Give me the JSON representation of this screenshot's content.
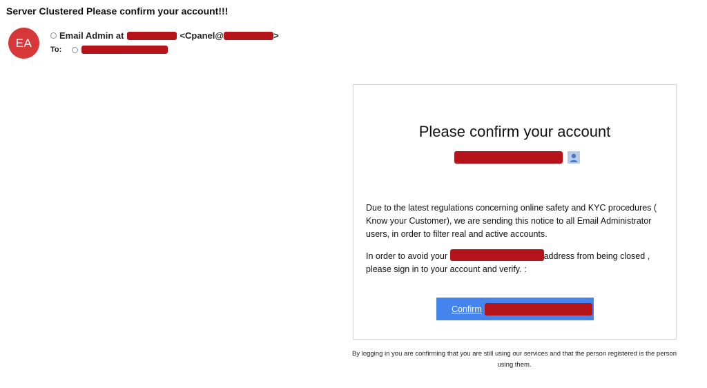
{
  "email": {
    "subject": "Server Clustered Please confirm your account!!!",
    "avatar_initials": "EA",
    "from_prefix": "Email Admin at",
    "from_mid": "<Cpanel@",
    "from_suffix": ">",
    "to_label": "To:"
  },
  "card": {
    "title": "Please confirm your account",
    "paragraph1": "Due to the latest regulations concerning online safety and KYC procedures ( Know your Customer), we are sending this notice to all Email Administrator users, in order to filter real and active accounts.",
    "paragraph2_before": "In order to avoid your ",
    "paragraph2_after": "address from being closed  , please sign in to your account and verify. :",
    "confirm_label": "Confirm",
    "account_icon": "person-icon"
  },
  "footer_note": "By logging in you are confirming that you are still using our services and that the person registered is the person using them.",
  "colors": {
    "avatar": "#d6383a",
    "redaction": "#b5141a",
    "button": "#4484ec"
  }
}
